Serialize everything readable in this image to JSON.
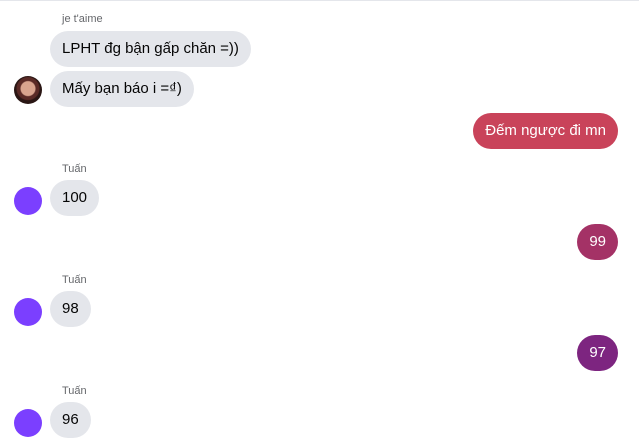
{
  "messages": {
    "group1": {
      "sender": "je t'aime",
      "m1": "LPHT đg bận gấp chăn =))",
      "m2": "Mấy bạn báo i =₫)"
    },
    "out1": {
      "text": "Đếm ngược đi mn",
      "color": "#c9435a"
    },
    "group2": {
      "sender": "Tuấn",
      "text": "100"
    },
    "out2": {
      "text": "99",
      "color": "#a43266"
    },
    "group3": {
      "sender": "Tuấn",
      "text": "98"
    },
    "out3": {
      "text": "97",
      "color": "#7d2580"
    },
    "group4": {
      "sender": "Tuấn",
      "text": "96"
    }
  },
  "colors": {
    "incoming_bubble": "#e4e6eb",
    "avatar_tuan": "#7b3fff"
  }
}
